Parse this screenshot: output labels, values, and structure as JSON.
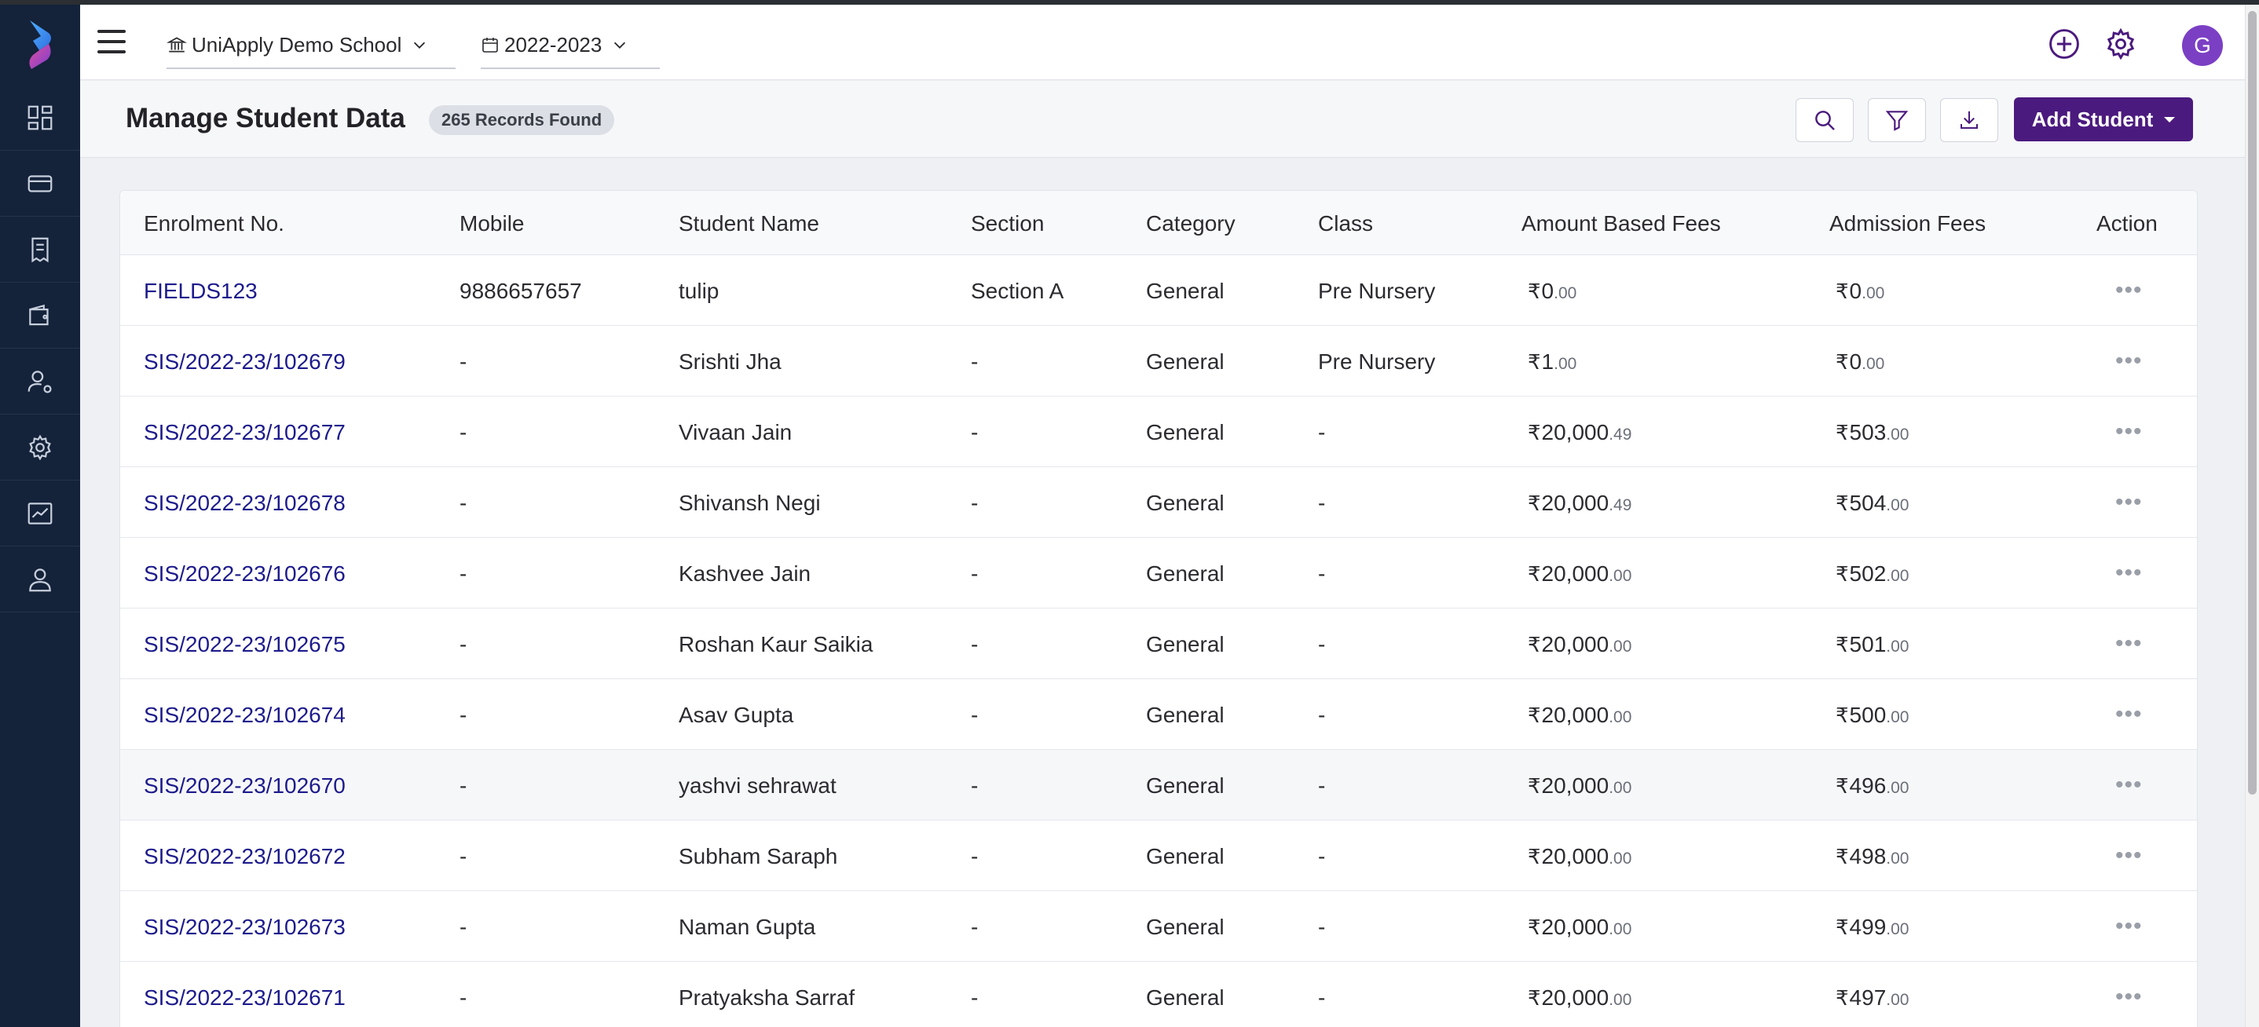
{
  "header": {
    "school": "UniApply Demo School",
    "year": "2022-2023",
    "avatar_initial": "G"
  },
  "page": {
    "title": "Manage Student Data",
    "records": "265 Records Found",
    "add_button": "Add Student"
  },
  "table": {
    "columns": [
      "Enrolment No.",
      "Mobile",
      "Student Name",
      "Section",
      "Category",
      "Class",
      "Amount Based Fees",
      "Admission Fees",
      "Action"
    ],
    "currency": "₹",
    "rows": [
      {
        "enrolment": "FIELDS123",
        "mobile": "9886657657",
        "name": "tulip",
        "section": "Section A",
        "category": "General",
        "class": "Pre Nursery",
        "amount_int": "0",
        "amount_dec": ".00",
        "admission_int": "0",
        "admission_dec": ".00"
      },
      {
        "enrolment": "SIS/2022-23/102679",
        "mobile": "-",
        "name": "Srishti Jha",
        "section": "-",
        "category": "General",
        "class": "Pre Nursery",
        "amount_int": "1",
        "amount_dec": ".00",
        "admission_int": "0",
        "admission_dec": ".00"
      },
      {
        "enrolment": "SIS/2022-23/102677",
        "mobile": "-",
        "name": "Vivaan Jain",
        "section": "-",
        "category": "General",
        "class": "-",
        "amount_int": "20,000",
        "amount_dec": ".49",
        "admission_int": "503",
        "admission_dec": ".00"
      },
      {
        "enrolment": "SIS/2022-23/102678",
        "mobile": "-",
        "name": "Shivansh Negi",
        "section": "-",
        "category": "General",
        "class": "-",
        "amount_int": "20,000",
        "amount_dec": ".49",
        "admission_int": "504",
        "admission_dec": ".00"
      },
      {
        "enrolment": "SIS/2022-23/102676",
        "mobile": "-",
        "name": "Kashvee Jain",
        "section": "-",
        "category": "General",
        "class": "-",
        "amount_int": "20,000",
        "amount_dec": ".00",
        "admission_int": "502",
        "admission_dec": ".00"
      },
      {
        "enrolment": "SIS/2022-23/102675",
        "mobile": "-",
        "name": "Roshan Kaur Saikia",
        "section": "-",
        "category": "General",
        "class": "-",
        "amount_int": "20,000",
        "amount_dec": ".00",
        "admission_int": "501",
        "admission_dec": ".00"
      },
      {
        "enrolment": "SIS/2022-23/102674",
        "mobile": "-",
        "name": "Asav Gupta",
        "section": "-",
        "category": "General",
        "class": "-",
        "amount_int": "20,000",
        "amount_dec": ".00",
        "admission_int": "500",
        "admission_dec": ".00"
      },
      {
        "enrolment": "SIS/2022-23/102670",
        "mobile": "-",
        "name": "yashvi sehrawat",
        "section": "-",
        "category": "General",
        "class": "-",
        "amount_int": "20,000",
        "amount_dec": ".00",
        "admission_int": "496",
        "admission_dec": ".00"
      },
      {
        "enrolment": "SIS/2022-23/102672",
        "mobile": "-",
        "name": "Subham Saraph",
        "section": "-",
        "category": "General",
        "class": "-",
        "amount_int": "20,000",
        "amount_dec": ".00",
        "admission_int": "498",
        "admission_dec": ".00"
      },
      {
        "enrolment": "SIS/2022-23/102673",
        "mobile": "-",
        "name": "Naman Gupta",
        "section": "-",
        "category": "General",
        "class": "-",
        "amount_int": "20,000",
        "amount_dec": ".00",
        "admission_int": "499",
        "admission_dec": ".00"
      },
      {
        "enrolment": "SIS/2022-23/102671",
        "mobile": "-",
        "name": "Pratyaksha Sarraf",
        "section": "-",
        "category": "General",
        "class": "-",
        "amount_int": "20,000",
        "amount_dec": ".00",
        "admission_int": "497",
        "admission_dec": ".00"
      }
    ]
  },
  "colors": {
    "sidebar": "#14223a",
    "primary": "#4b1a7e",
    "link": "#1d1b8c",
    "avatar": "#7b3fc4"
  }
}
